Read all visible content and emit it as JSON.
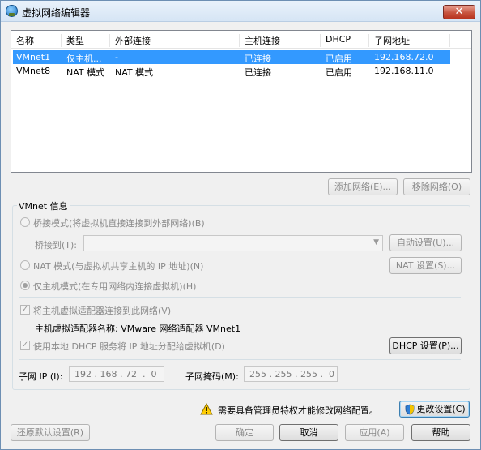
{
  "window": {
    "title": "虚拟网络编辑器",
    "close_label": "✕"
  },
  "table": {
    "columns": [
      "名称",
      "类型",
      "外部连接",
      "主机连接",
      "DHCP",
      "子网地址"
    ],
    "rows": [
      {
        "name": "VMnet1",
        "type": "仅主机...",
        "external": "-",
        "host": "已连接",
        "dhcp": "已启用",
        "subnet": "192.168.72.0",
        "selected": true
      },
      {
        "name": "VMnet8",
        "type": "NAT 模式",
        "external": "NAT 模式",
        "host": "已连接",
        "dhcp": "已启用",
        "subnet": "192.168.11.0",
        "selected": false
      }
    ]
  },
  "table_buttons": {
    "add": "添加网络(E)...",
    "remove": "移除网络(O)"
  },
  "vmnet_info": {
    "title": "VMnet 信息",
    "bridge_radio": "桥接模式(将虚拟机直接连接到外部网络)(B)",
    "bridge_to_label": "桥接到(T):",
    "bridge_to_value": "",
    "auto_button": "自动设置(U)...",
    "nat_radio": "NAT 模式(与虚拟机共享主机的 IP 地址)(N)",
    "nat_button": "NAT 设置(S)...",
    "hostonly_radio": "仅主机模式(在专用网络内连接虚拟机)(H)",
    "connect_check": "将主机虚拟适配器连接到此网络(V)",
    "adapter_name": "主机虚拟适配器名称: VMware 网络适配器 VMnet1",
    "dhcp_check": "使用本地 DHCP 服务将 IP 地址分配给虚拟机(D)",
    "dhcp_button": "DHCP 设置(P)...",
    "subnet_ip_label": "子网 IP (I):",
    "subnet_ip": "192 . 168 . 72  .  0",
    "mask_label": "子网掩码(M):",
    "mask": "255 . 255 . 255 .  0"
  },
  "admin": {
    "warning": "需要具备管理员特权才能修改网络配置。",
    "change_button": "更改设置(C)"
  },
  "footer": {
    "restore": "还原默认设置(R)",
    "ok": "确定",
    "cancel": "取消",
    "apply": "应用(A)",
    "help": "帮助"
  }
}
